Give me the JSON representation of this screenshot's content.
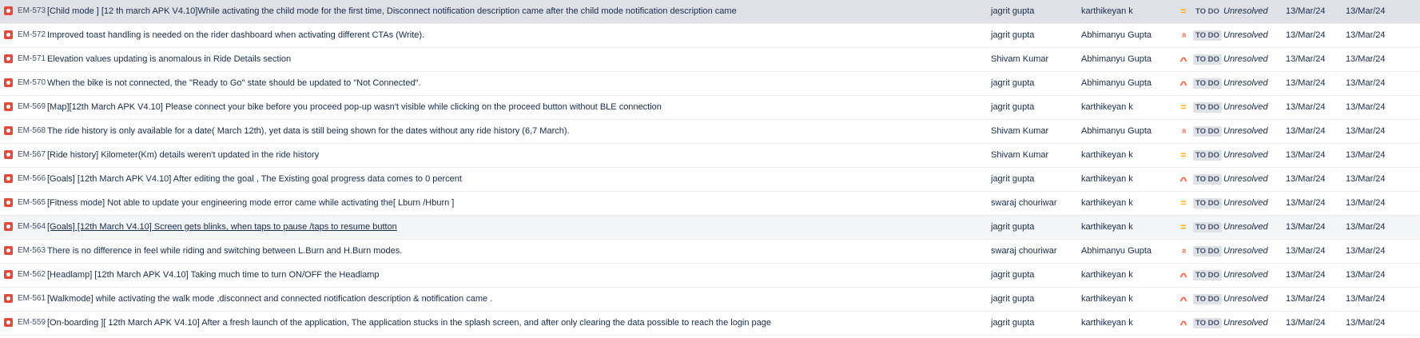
{
  "colors": {
    "bug": "#e5493a",
    "priority_medium": "#ffab00",
    "priority_high": "#ff5630",
    "priority_highest": "#ff7452",
    "status_bg": "#dfe1e6"
  },
  "issues": [
    {
      "key": "EM-573",
      "summary": "[Child mode ] [12 th march APK V4.10]While activating the child mode for the first time, Disconnect notification description came after the child mode notification description came",
      "reporter": "jagrit gupta",
      "assignee": "karthikeyan k",
      "priority_icon": "=",
      "priority_color": "#ffab00",
      "status": "TO DO",
      "resolution": "Unresolved",
      "created": "13/Mar/24",
      "updated": "13/Mar/24"
    },
    {
      "key": "EM-572",
      "summary": "Improved toast handling is needed on the rider dashboard when activating different CTAs (Write).",
      "reporter": "jagrit gupta",
      "assignee": "Abhimanyu Gupta",
      "priority_icon": "»",
      "priority_color": "#ff7452",
      "status": "TO DO",
      "resolution": "Unresolved",
      "created": "13/Mar/24",
      "updated": "13/Mar/24"
    },
    {
      "key": "EM-571",
      "summary": "Elevation values updating is anomalous in Ride Details section",
      "reporter": "Shivam Kumar",
      "assignee": "Abhimanyu Gupta",
      "priority_icon": "^",
      "priority_color": "#ff5630",
      "status": "TO DO",
      "resolution": "Unresolved",
      "created": "13/Mar/24",
      "updated": "13/Mar/24"
    },
    {
      "key": "EM-570",
      "summary": "When the bike is not connected, the \"Ready to Go\" state should be updated to \"Not Connected\".",
      "reporter": "jagrit gupta",
      "assignee": "Abhimanyu Gupta",
      "priority_icon": "^",
      "priority_color": "#ff5630",
      "status": "TO DO",
      "resolution": "Unresolved",
      "created": "13/Mar/24",
      "updated": "13/Mar/24"
    },
    {
      "key": "EM-569",
      "summary": "[Map][12th March APK V4.10] Please connect your bike before you proceed pop-up wasn't visible while clicking on the proceed button without BLE connection",
      "reporter": "jagrit gupta",
      "assignee": "karthikeyan k",
      "priority_icon": "=",
      "priority_color": "#ffab00",
      "status": "TO DO",
      "resolution": "Unresolved",
      "created": "13/Mar/24",
      "updated": "13/Mar/24"
    },
    {
      "key": "EM-568",
      "summary": "The ride history is only available for a date( March 12th), yet data is still being shown for the dates without any ride history (6,7 March).",
      "reporter": "Shivam Kumar",
      "assignee": "Abhimanyu Gupta",
      "priority_icon": "»",
      "priority_color": "#ff7452",
      "status": "TO DO",
      "resolution": "Unresolved",
      "created": "13/Mar/24",
      "updated": "13/Mar/24"
    },
    {
      "key": "EM-567",
      "summary": "[Ride history] Kilometer(Km) details weren't updated in the ride history",
      "reporter": "Shivam Kumar",
      "assignee": "karthikeyan k",
      "priority_icon": "=",
      "priority_color": "#ffab00",
      "status": "TO DO",
      "resolution": "Unresolved",
      "created": "13/Mar/24",
      "updated": "13/Mar/24"
    },
    {
      "key": "EM-566",
      "summary": "[Goals] [12th March APK V4.10] After editing the goal , The Existing goal progress data comes to 0 percent",
      "reporter": "jagrit gupta",
      "assignee": "karthikeyan k",
      "priority_icon": "^",
      "priority_color": "#ff5630",
      "status": "TO DO",
      "resolution": "Unresolved",
      "created": "13/Mar/24",
      "updated": "13/Mar/24"
    },
    {
      "key": "EM-565",
      "summary": "[Fitness mode] Not able to update your engineering mode error came while activating the[ Lburn /Hburn ]",
      "reporter": "swaraj chouriwar",
      "assignee": "karthikeyan k",
      "priority_icon": "=",
      "priority_color": "#ffab00",
      "status": "TO DO",
      "resolution": "Unresolved",
      "created": "13/Mar/24",
      "updated": "13/Mar/24"
    },
    {
      "key": "EM-564",
      "summary": "[Goals] [12th March V4.10] Screen gets blinks, when taps to pause /taps to resume button",
      "reporter": "jagrit gupta",
      "assignee": "karthikeyan k",
      "priority_icon": "=",
      "priority_color": "#ffab00",
      "status": "TO DO",
      "resolution": "Unresolved",
      "created": "13/Mar/24",
      "updated": "13/Mar/24"
    },
    {
      "key": "EM-563",
      "summary": "There is no difference in feel while riding and switching between L.Burn and H.Burn modes.",
      "reporter": "swaraj chouriwar",
      "assignee": "Abhimanyu Gupta",
      "priority_icon": "»",
      "priority_color": "#ff7452",
      "status": "TO DO",
      "resolution": "Unresolved",
      "created": "13/Mar/24",
      "updated": "13/Mar/24"
    },
    {
      "key": "EM-562",
      "summary": "[Headlamp] [12th March APK V4.10] Taking much time to turn ON/OFF the Headlamp",
      "reporter": "jagrit gupta",
      "assignee": "karthikeyan k",
      "priority_icon": "^",
      "priority_color": "#ff5630",
      "status": "TO DO",
      "resolution": "Unresolved",
      "created": "13/Mar/24",
      "updated": "13/Mar/24"
    },
    {
      "key": "EM-561",
      "summary": "[Walkmode] while activating the walk mode ,disconnect and connected notification description & notification came .",
      "reporter": "jagrit gupta",
      "assignee": "karthikeyan k",
      "priority_icon": "^",
      "priority_color": "#ff5630",
      "status": "TO DO",
      "resolution": "Unresolved",
      "created": "13/Mar/24",
      "updated": "13/Mar/24"
    },
    {
      "key": "EM-559",
      "summary": "[On-boarding ][ 12th March APK V4.10] After a fresh launch of the application, The application stucks in the splash screen, and after only clearing the data possible to reach the login page",
      "reporter": "jagrit gupta",
      "assignee": "karthikeyan k",
      "priority_icon": "^",
      "priority_color": "#ff5630",
      "status": "TO DO",
      "resolution": "Unresolved",
      "created": "13/Mar/24",
      "updated": "13/Mar/24"
    }
  ]
}
